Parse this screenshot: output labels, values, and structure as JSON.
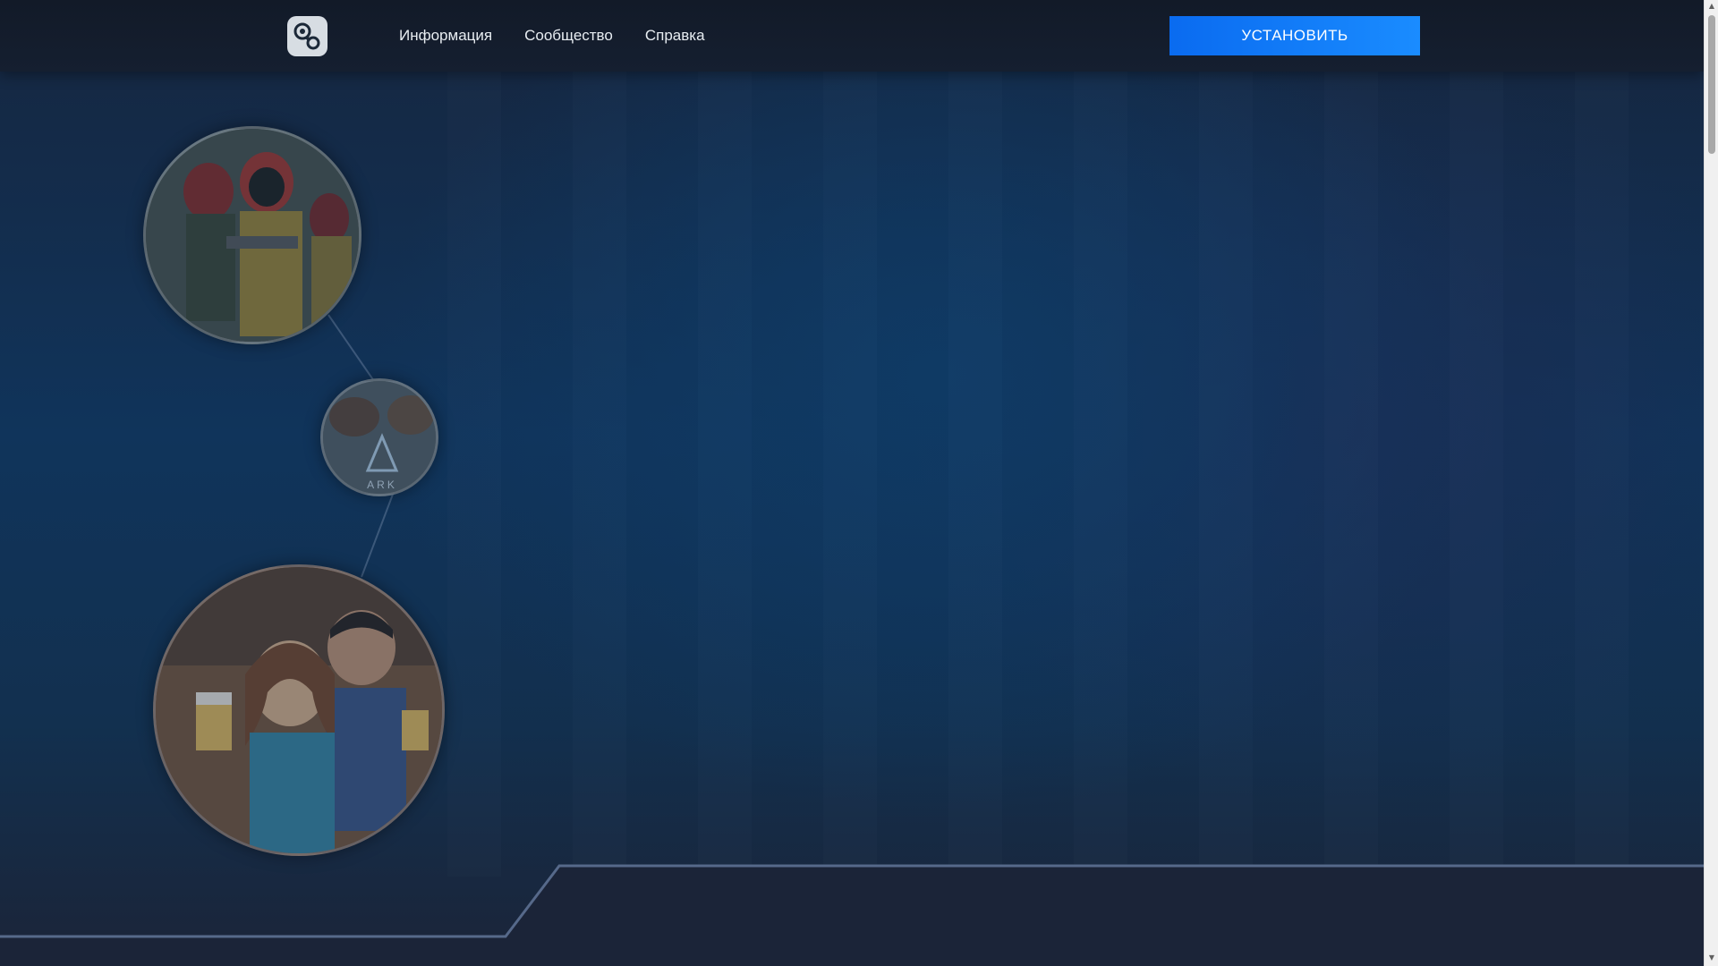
{
  "header": {
    "logo_icon": "steam-logo-icon",
    "nav": [
      {
        "label": "Информация"
      },
      {
        "label": "Сообщество"
      },
      {
        "label": "Справка"
      }
    ],
    "install_label": "УСТАНОВИТЬ"
  },
  "showcase": {
    "bubbles": [
      {
        "icon": "game-art-soldiers-image"
      },
      {
        "icon": "game-art-ark-image"
      },
      {
        "icon": "game-art-tavern-image"
      }
    ]
  },
  "colors": {
    "accent": "#1a8cff",
    "header_bg": "#131c2b",
    "page_bg": "#10345b"
  }
}
